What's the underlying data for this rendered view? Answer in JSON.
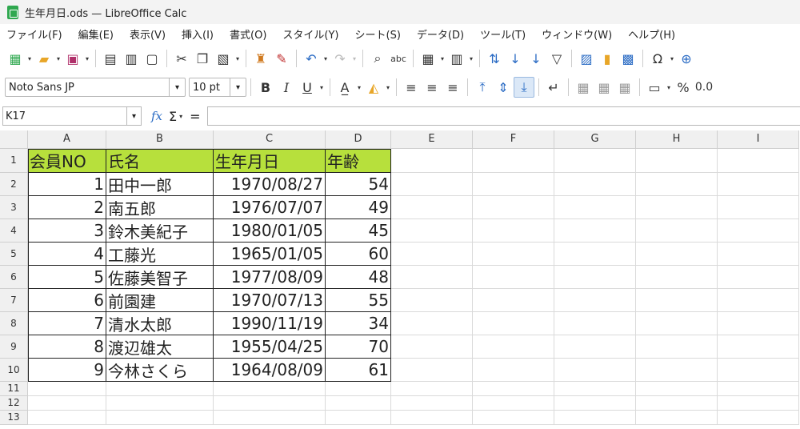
{
  "window": {
    "title": "生年月日.ods — LibreOffice Calc"
  },
  "menu": [
    "ファイル(F)",
    "編集(E)",
    "表示(V)",
    "挿入(I)",
    "書式(O)",
    "スタイル(Y)",
    "シート(S)",
    "データ(D)",
    "ツール(T)",
    "ウィンドウ(W)",
    "ヘルプ(H)"
  ],
  "toolbar2": {
    "font_name": "Noto Sans JP",
    "font_size": "10 pt",
    "bold": "B",
    "italic": "I",
    "underline": "U",
    "percent": "%",
    "decimal": "0.0"
  },
  "formula_bar": {
    "cell_ref": "K17",
    "fx": "fx",
    "sum": "Σ",
    "equals": "=",
    "value": ""
  },
  "columns": [
    "A",
    "B",
    "C",
    "D",
    "E",
    "F",
    "G",
    "H",
    "I"
  ],
  "rows": [
    "1",
    "2",
    "3",
    "4",
    "5",
    "6",
    "7",
    "8",
    "9",
    "10",
    "11",
    "12",
    "13"
  ],
  "sheet": {
    "header": [
      "会員NO",
      "氏名",
      "生年月日",
      "年齢"
    ],
    "records": [
      [
        "1",
        "田中一郎",
        "1970/08/27",
        "54"
      ],
      [
        "2",
        "南五郎",
        "1976/07/07",
        "49"
      ],
      [
        "3",
        "鈴木美紀子",
        "1980/01/05",
        "45"
      ],
      [
        "4",
        "工藤光",
        "1965/01/05",
        "60"
      ],
      [
        "5",
        "佐藤美智子",
        "1977/08/09",
        "48"
      ],
      [
        "6",
        "前園建",
        "1970/07/13",
        "55"
      ],
      [
        "7",
        "清水太郎",
        "1990/11/19",
        "34"
      ],
      [
        "8",
        "渡辺雄太",
        "1955/04/25",
        "70"
      ],
      [
        "9",
        "今林さくら",
        "1964/08/09",
        "61"
      ]
    ]
  },
  "colors": {
    "header_fill": "#b7e03c",
    "accent": "#2a6bc4"
  }
}
